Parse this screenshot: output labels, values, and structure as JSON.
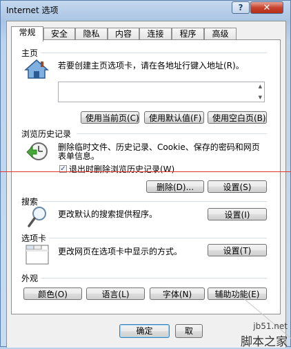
{
  "window": {
    "title": "Internet 选项",
    "help_glyph": "?",
    "close_glyph": "✕"
  },
  "tabs": [
    "常规",
    "安全",
    "隐私",
    "内容",
    "连接",
    "程序",
    "高级"
  ],
  "homepage": {
    "title": "主页",
    "description": "若要创建主页选项卡，请在各地址行键入地址(R)。",
    "value": "",
    "buttons": {
      "use_current": "使用当前页(C)",
      "use_default": "使用默认值(F)",
      "use_blank": "使用空白页(B)"
    }
  },
  "history": {
    "title": "浏览历史记录",
    "description_line1": "删除临时文件、历史记录、Cookie、保存的密码和网页",
    "description_line2": "表单信息。",
    "checkbox_label": "退出时删除浏览历史记录(W)",
    "checkbox_checked": true,
    "buttons": {
      "delete": "删除(D)...",
      "settings": "设置(S)"
    }
  },
  "search": {
    "title": "搜索",
    "description": "更改默认的搜索提供程序。",
    "button": "设置(I)"
  },
  "tabs_section": {
    "title": "选项卡",
    "description": "更改网页在选项卡中显示的方式。",
    "button": "设置(T)"
  },
  "appearance": {
    "title": "外观",
    "buttons": {
      "colors": "颜色(O)",
      "languages": "语言(L)",
      "fonts": "字体(N)",
      "accessibility": "辅助功能(E)"
    }
  },
  "footer": {
    "ok": "确定",
    "cancel": "取"
  },
  "watermark": {
    "site": "jb51.net",
    "brand": "脚本之家"
  },
  "colors": {
    "annotation_line": "#e0332a",
    "titlebar": "#a9c4e3",
    "close_button": "#c7442f"
  }
}
